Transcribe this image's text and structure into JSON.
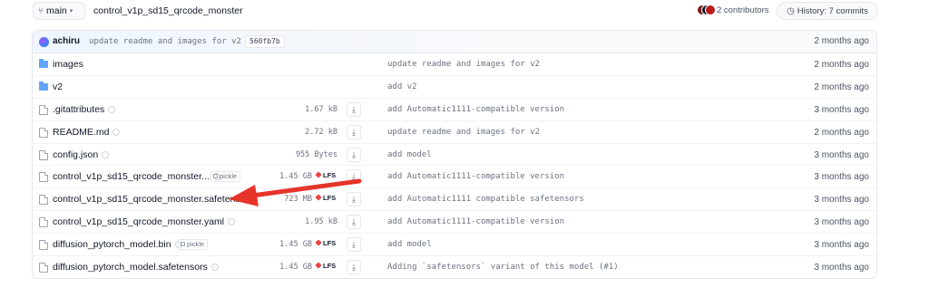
{
  "header": {
    "branch": "main",
    "branch_icon": "git-branch-icon",
    "repo_path": "control_v1p_sd15_qrcode_monster",
    "contributors_label": "2 contributors",
    "history_label": "History: 7 commits"
  },
  "last_commit": {
    "author": "achiru",
    "message": "update readme and images for v2",
    "sha": "560fb7b",
    "time": "2 months ago"
  },
  "files": [
    {
      "type": "folder",
      "name": "images",
      "size": "",
      "lfs": false,
      "pickle": false,
      "commit": "update readme and images for v2",
      "time": "2 months ago"
    },
    {
      "type": "folder",
      "name": "v2",
      "size": "",
      "lfs": false,
      "pickle": false,
      "commit": "add v2",
      "time": "2 months ago"
    },
    {
      "type": "file",
      "name": ".gitattributes",
      "size": "1.67 kB",
      "lfs": false,
      "pickle": false,
      "commit": "add Automatic1111-compatible version",
      "time": "3 months ago"
    },
    {
      "type": "file",
      "name": "README.md",
      "size": "2.72 kB",
      "lfs": false,
      "pickle": false,
      "commit": "update readme and images for v2",
      "time": "2 months ago"
    },
    {
      "type": "file",
      "name": "config.json",
      "size": "955 Bytes",
      "lfs": false,
      "pickle": false,
      "commit": "add model",
      "time": "3 months ago"
    },
    {
      "type": "file",
      "name": "control_v1p_sd15_qrcode_monster...",
      "size": "1.45 GB",
      "lfs": true,
      "pickle": true,
      "commit": "add Automatic1111-compatible version",
      "time": "3 months ago"
    },
    {
      "type": "file",
      "name": "control_v1p_sd15_qrcode_monster.safetens...",
      "size": "723 MB",
      "lfs": true,
      "pickle": false,
      "commit": "add Automatic1111 compatible safetensors",
      "time": "3 months ago"
    },
    {
      "type": "file",
      "name": "control_v1p_sd15_qrcode_monster.yaml",
      "size": "1.95 kB",
      "lfs": false,
      "pickle": false,
      "commit": "add Automatic1111-compatible version",
      "time": "3 months ago"
    },
    {
      "type": "file",
      "name": "diffusion_pytorch_model.bin",
      "size": "1.45 GB",
      "lfs": true,
      "pickle": true,
      "commit": "add model",
      "time": "3 months ago"
    },
    {
      "type": "file",
      "name": "diffusion_pytorch_model.safetensors",
      "size": "1.45 GB",
      "lfs": true,
      "pickle": false,
      "commit": "Adding `safetensors` variant of this model (#1)",
      "time": "3 months ago"
    }
  ],
  "labels": {
    "pickle": "pickle",
    "lfs": "LFS",
    "download_icon": "download-icon"
  },
  "annotation": {
    "color": "#e5352b",
    "icon": "red-arrow-annotation"
  }
}
